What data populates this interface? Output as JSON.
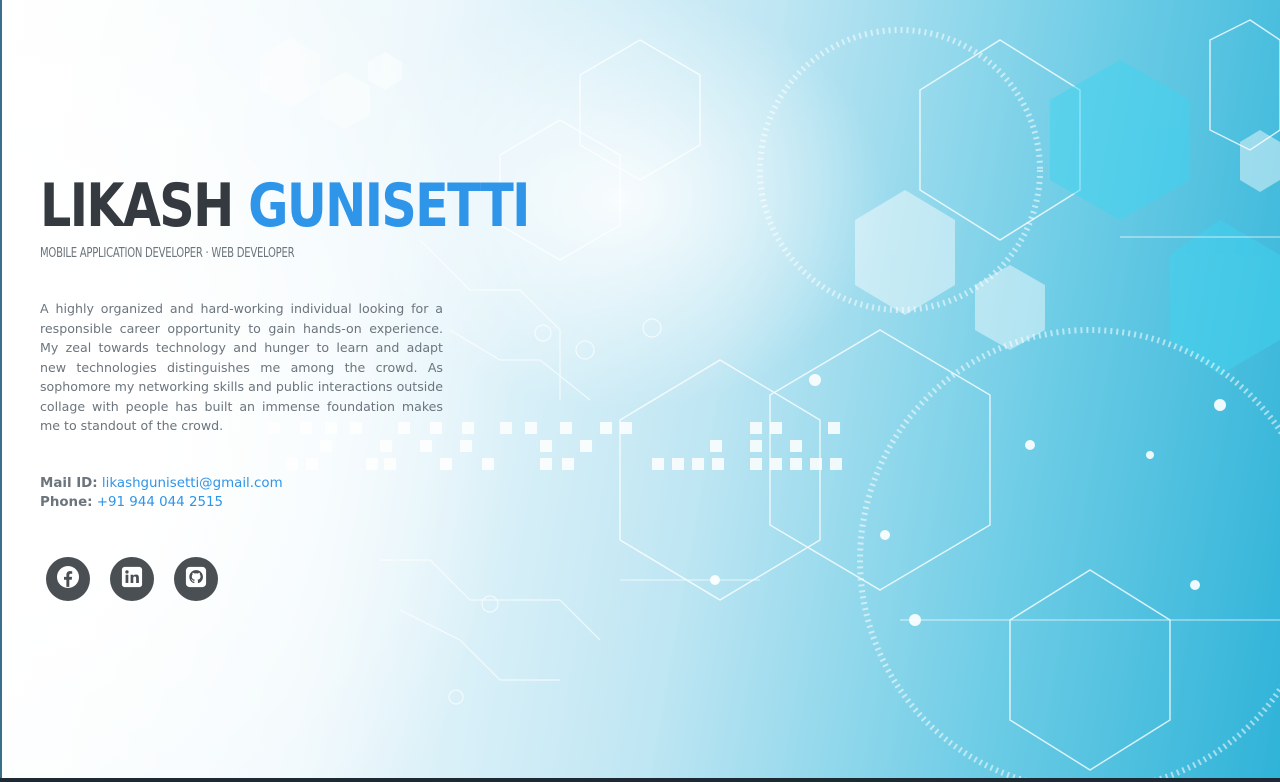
{
  "profile": {
    "first_name": "LIKASH",
    "last_name": "GUNISETTI",
    "subheading": "MOBILE APPLICATION DEVELOPER · WEB DEVELOPER",
    "bio": "A highly organized and hard-working individual looking for a responsible career opportunity to gain hands-on experience. My zeal towards technology and hunger to learn and adapt new technologies distinguishes me among the crowd. As sophomore my networking skills and public interactions outside collage with people has built an immense foundation makes me to standout of the crowd."
  },
  "contact": {
    "mail_label": "Mail ID:",
    "mail_value": "likashgunisetti@gmail.com",
    "phone_label": "Phone:",
    "phone_value": "+91 944 044 2515"
  },
  "social": [
    {
      "icon": "facebook-icon"
    },
    {
      "icon": "linkedin-icon"
    },
    {
      "icon": "github-icon"
    }
  ],
  "colors": {
    "accent": "#2f95e8",
    "dark": "#343a40",
    "muted": "#6c757d",
    "social_bg": "#4a4f54"
  }
}
